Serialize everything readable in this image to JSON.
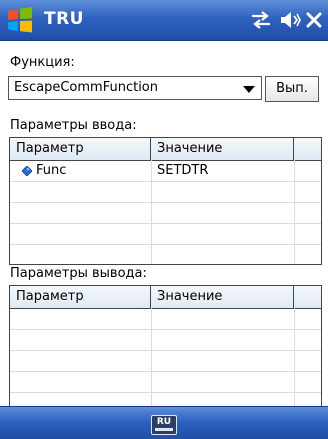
{
  "title_bar": {
    "app_title": "TRU",
    "logo_icon": "windows-flag-icon",
    "connectivity_icon": "connectivity-arrows-icon",
    "volume_icon": "speaker-icon",
    "close_icon": "close-icon"
  },
  "function": {
    "label": "Функция:",
    "selected_value": "EscapeCommFunction",
    "run_button_label": "Вып."
  },
  "input_params": {
    "label": "Параметры ввода:",
    "columns": [
      "Параметр",
      "Значение"
    ],
    "rows": [
      {
        "name": "Func",
        "value": "SETDTR",
        "icon": "param-diamond-icon"
      }
    ]
  },
  "output_params": {
    "label": "Параметры вывода:",
    "columns": [
      "Параметр",
      "Значение"
    ],
    "rows": []
  },
  "bottom_bar": {
    "input_method_label": "RU",
    "input_method_icon": "keyboard-icon"
  },
  "colors": {
    "titlebar_blue": "#2f62c0",
    "grid_header": "#dfe9f4"
  }
}
